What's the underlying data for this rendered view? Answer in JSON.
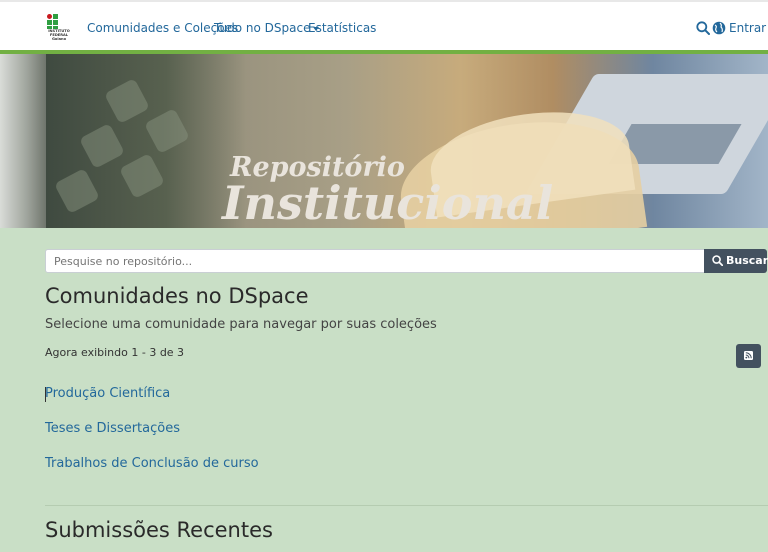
{
  "header": {
    "logo_text": "INSTITUTO FEDERAL Goiano",
    "nav": [
      {
        "label": "Comunidades e Coleções",
        "dropdown": false
      },
      {
        "label": "Tudo no DSpace",
        "dropdown": true
      },
      {
        "label": "Estatísticas",
        "dropdown": false
      }
    ],
    "search_icon": "search-icon",
    "language_icon": "globe-icon",
    "login_label": "Entrar"
  },
  "banner": {
    "line1": "Repositório",
    "line2": "Institucional"
  },
  "search": {
    "placeholder": "Pesquise no repositório...",
    "button_label": "Buscar"
  },
  "main": {
    "title": "Comunidades no DSpace",
    "subtitle": "Selecione uma comunidade para navegar por suas coleções",
    "showing": "Agora exibindo 1 - 3 de 3",
    "rss_icon": "rss-icon",
    "communities": [
      "Produção Científica",
      "Teses e Dissertações",
      "Trabalhos de Conclusão de curso"
    ],
    "recent_title": "Submissões Recentes"
  },
  "colors": {
    "page_bg": "#c9dfc6",
    "link": "#23689b",
    "accent_bar": "#72b043",
    "button_bg": "#43515f"
  }
}
